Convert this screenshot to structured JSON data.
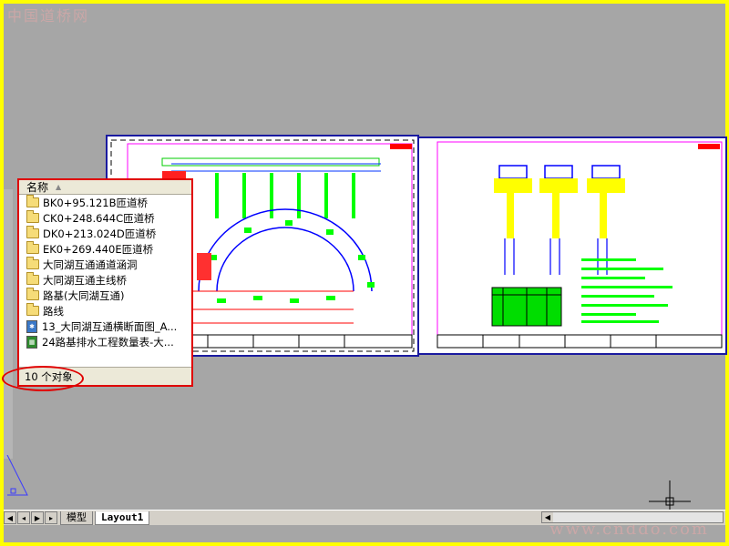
{
  "watermark": {
    "top_left": "中国道桥网",
    "bottom_right": "www.cnddo.com"
  },
  "panel": {
    "column_header": "名称",
    "items": [
      {
        "label": "BK0+95.121B匝道桥",
        "icon": "folder-icon"
      },
      {
        "label": "CK0+248.644C匝道桥",
        "icon": "folder-icon"
      },
      {
        "label": "DK0+213.024D匝道桥",
        "icon": "folder-icon"
      },
      {
        "label": "EK0+269.440E匝道桥",
        "icon": "folder-icon"
      },
      {
        "label": "大同湖互通通道涵洞",
        "icon": "folder-icon"
      },
      {
        "label": "大同湖互通主线桥",
        "icon": "folder-icon"
      },
      {
        "label": "路基(大同湖互通)",
        "icon": "folder-icon"
      },
      {
        "label": "路线",
        "icon": "folder-icon"
      },
      {
        "label": "13_大同湖互通横断面图_A...",
        "icon": "drawing-file-icon"
      },
      {
        "label": "24路基排水工程数量表-大...",
        "icon": "spreadsheet-file-icon"
      }
    ],
    "status": "10 个对象"
  },
  "tabs": {
    "model": "模型",
    "layout": "Layout1"
  },
  "colors": {
    "background": "#a6a6a6",
    "border": "#ffff00",
    "highlight": "#e00000",
    "sheet_border": "#1a1aa0"
  }
}
